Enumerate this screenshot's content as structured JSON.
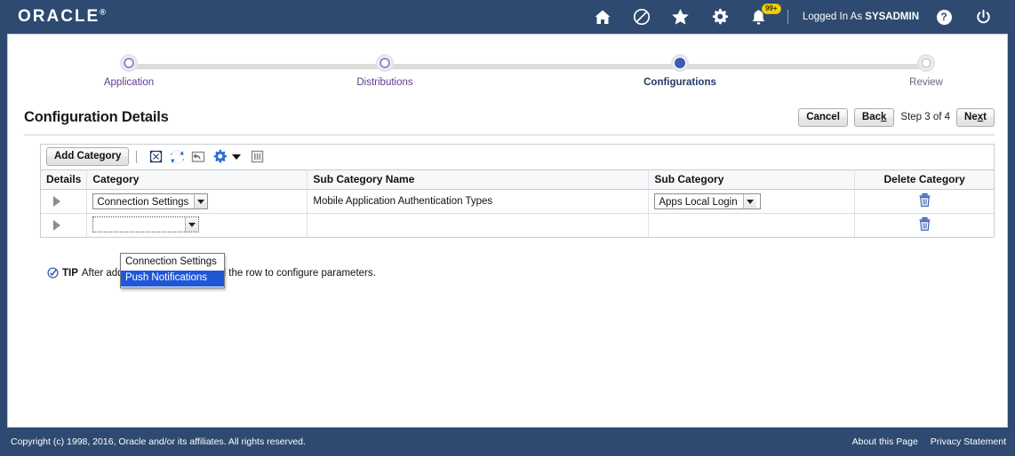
{
  "header": {
    "logo": "ORACLE",
    "logo_tm": "®",
    "icons": [
      {
        "name": "home-icon",
        "label": "Home"
      },
      {
        "name": "no-entry-icon",
        "label": "Blocked"
      },
      {
        "name": "favorites-star-icon",
        "label": "Favorites"
      },
      {
        "name": "settings-gear-icon",
        "label": "Settings"
      },
      {
        "name": "notifications-bell-icon",
        "label": "Notifications",
        "badge": "99+"
      }
    ],
    "logged_in_prefix": "Logged In As",
    "logged_in_user": "SYSADMIN",
    "help_glyph": "?",
    "power_label": "Logout"
  },
  "train": {
    "steps": [
      {
        "label": "Application",
        "state": "done"
      },
      {
        "label": "Distributions",
        "state": "done"
      },
      {
        "label": "Configurations",
        "state": "current"
      },
      {
        "label": "Review",
        "state": "todo"
      }
    ]
  },
  "page": {
    "title": "Configuration Details",
    "cancel_label": "Cancel",
    "back_label_pre": "Bac",
    "back_label_key": "k",
    "step_text": "Step 3 of 4",
    "next_label_pre": "Ne",
    "next_label_key": "x",
    "next_label_post": "t"
  },
  "toolbar": {
    "add_category_label": "Add Category",
    "icons": [
      {
        "name": "expand-arrows-icon",
        "title": "Expand All"
      },
      {
        "name": "refresh-icon",
        "title": "Refresh"
      },
      {
        "name": "export-icon",
        "title": "Export"
      },
      {
        "name": "gear-icon",
        "title": "Actions"
      },
      {
        "name": "columns-icon",
        "title": "Columns"
      }
    ]
  },
  "table": {
    "columns": [
      "Details",
      "Category",
      "Sub Category Name",
      "Sub Category",
      "Delete Category"
    ],
    "rows": [
      {
        "category": "Connection Settings",
        "sub_category_name": "Mobile Application Authentication Types",
        "sub_category": "Apps Local Login",
        "delete_icon": "trash-icon"
      },
      {
        "category": "",
        "sub_category_name": "",
        "sub_category": "",
        "delete_icon": "trash-icon"
      }
    ]
  },
  "dropdown": {
    "options": [
      "Connection Settings",
      "Push Notifications"
    ],
    "selected": "Push Notifications"
  },
  "tip": {
    "label": "TIP",
    "text": "After adding a category, expand the row to configure parameters."
  },
  "footer": {
    "copyright": "Copyright (c) 1998, 2016, Oracle and/or its affiliates. All rights reserved.",
    "links": [
      "About this Page",
      "Privacy Statement"
    ]
  },
  "colors": {
    "brand_navy": "#2e4a70",
    "accent_blue": "#3b5bb5",
    "link_purple": "#5c3d8f",
    "badge_yellow": "#f5d10a",
    "highlight_blue": "#1f57d6"
  }
}
